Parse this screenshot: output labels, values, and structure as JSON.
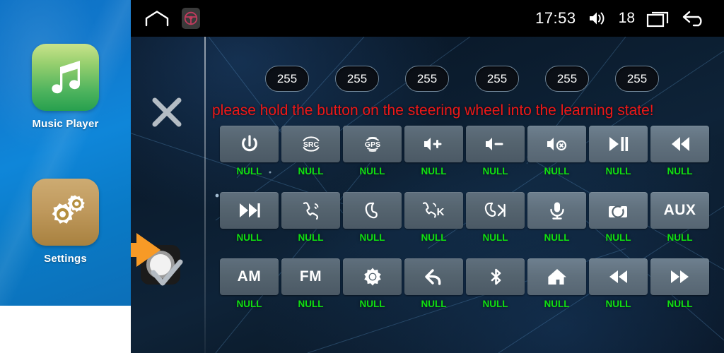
{
  "launcher": {
    "apps": [
      {
        "label": "Music Player",
        "icon": "music-note-icon"
      },
      {
        "label": "Settings",
        "icon": "gears-icon"
      }
    ]
  },
  "statusbar": {
    "home_icon": "home-outline-icon",
    "steering_icon": "steering-wheel-icon",
    "clock": "17:53",
    "volume_icon": "volume-icon",
    "volume_value": "18",
    "recents_icon": "recent-apps-icon",
    "back_icon": "back-arrow-icon"
  },
  "rail": {
    "cancel_icon": "close-x-icon",
    "confirm_icon": "checkmark-icon",
    "pointer_icon": "orange-arrow-icon",
    "touch_icon": "touch-circle-button"
  },
  "pills": [
    {
      "value": "255"
    },
    {
      "value": "255"
    },
    {
      "value": "255"
    },
    {
      "value": "255"
    },
    {
      "value": "255"
    },
    {
      "value": "255"
    }
  ],
  "warning": {
    "text": "please hold the button on the steering wheel into the learning state!"
  },
  "grid": {
    "rows": [
      [
        {
          "icon": "power-icon",
          "label": "NULL",
          "lit": false
        },
        {
          "icon": "src-icon",
          "label": "NULL",
          "lit": false
        },
        {
          "icon": "gps-icon",
          "label": "NULL",
          "lit": false
        },
        {
          "icon": "volume-up-icon",
          "label": "NULL",
          "lit": false
        },
        {
          "icon": "volume-down-icon",
          "label": "NULL",
          "lit": false
        },
        {
          "icon": "volume-mute-icon",
          "label": "NULL",
          "lit": true
        },
        {
          "icon": "play-pause-icon",
          "label": "NULL",
          "lit": true
        },
        {
          "icon": "previous-track-icon",
          "label": "NULL",
          "lit": true
        }
      ],
      [
        {
          "icon": "next-track-icon",
          "label": "NULL",
          "lit": false
        },
        {
          "icon": "answer-call-icon",
          "label": "NULL",
          "lit": false
        },
        {
          "icon": "end-call-icon",
          "label": "NULL",
          "lit": false
        },
        {
          "icon": "call-k-icon",
          "label": "NULL",
          "lit": false
        },
        {
          "icon": "end-call-skip-icon",
          "label": "NULL",
          "lit": false
        },
        {
          "icon": "microphone-icon",
          "label": "NULL",
          "lit": true
        },
        {
          "icon": "camera-icon",
          "label": "NULL",
          "lit": true
        },
        {
          "icon": "aux-icon",
          "label": "NULL",
          "lit": true,
          "text": "AUX"
        }
      ],
      [
        {
          "icon": "am-icon",
          "label": "NULL",
          "lit": false,
          "text": "AM"
        },
        {
          "icon": "fm-icon",
          "label": "NULL",
          "lit": false,
          "text": "FM"
        },
        {
          "icon": "brightness-icon",
          "label": "NULL",
          "lit": false
        },
        {
          "icon": "back-return-icon",
          "label": "NULL",
          "lit": false
        },
        {
          "icon": "bluetooth-icon",
          "label": "NULL",
          "lit": false
        },
        {
          "icon": "home-icon",
          "label": "NULL",
          "lit": true
        },
        {
          "icon": "rewind-icon",
          "label": "NULL",
          "lit": true
        },
        {
          "icon": "fast-forward-icon",
          "label": "NULL",
          "lit": true
        }
      ]
    ]
  },
  "colors": {
    "warning_red": "#ef1818",
    "label_green": "#10e010",
    "launcher_blue": "#0f86d9",
    "key_grey": "#55646f"
  }
}
